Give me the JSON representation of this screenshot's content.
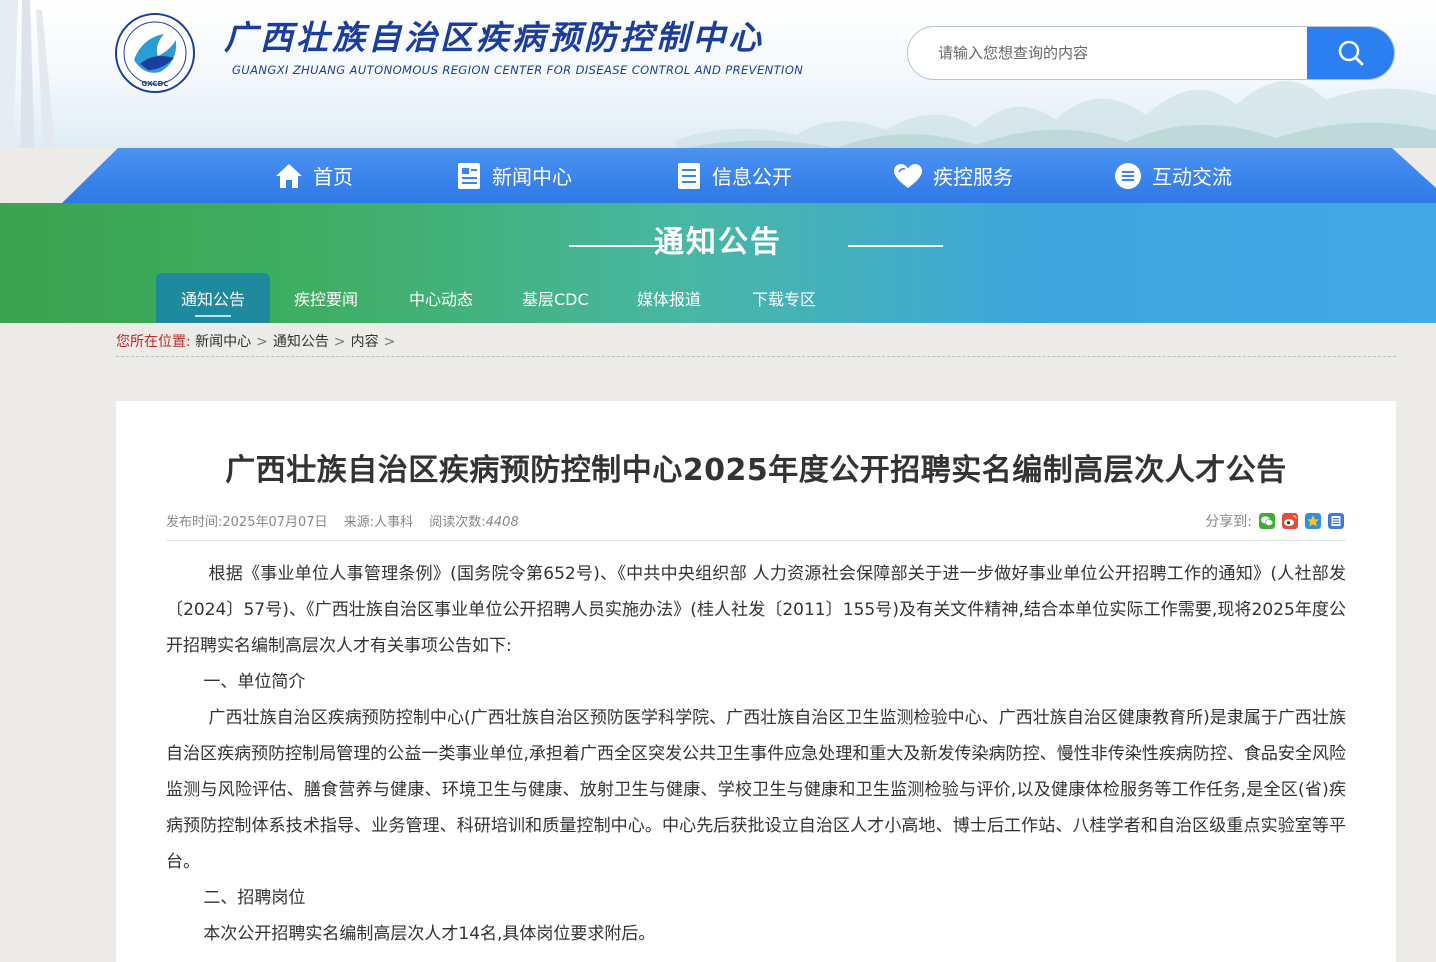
{
  "site": {
    "name_cn": "广西壮族自治区疾病预防控制中心",
    "name_en": "GUANGXI ZHUANG AUTONOMOUS REGION CENTER FOR DISEASE CONTROL AND PREVENTION",
    "logo_text": "GXCDC"
  },
  "search": {
    "placeholder": "请输入您想查询的内容"
  },
  "nav": {
    "items": [
      {
        "label": "首页",
        "icon": "home-icon"
      },
      {
        "label": "新闻中心",
        "icon": "news-icon"
      },
      {
        "label": "信息公开",
        "icon": "document-icon"
      },
      {
        "label": "疾控服务",
        "icon": "heart-icon"
      },
      {
        "label": "互动交流",
        "icon": "chat-icon"
      }
    ]
  },
  "banner": {
    "title": "通知公告"
  },
  "subnav": {
    "items": [
      {
        "label": "通知公告",
        "active": true
      },
      {
        "label": "疾控要闻"
      },
      {
        "label": "中心动态"
      },
      {
        "label": "基层CDC"
      },
      {
        "label": "媒体报道"
      },
      {
        "label": "下载专区"
      }
    ]
  },
  "breadcrumb": {
    "label": "您所在位置:",
    "items": [
      "新闻中心",
      "通知公告",
      "内容"
    ],
    "sep": ">"
  },
  "article": {
    "title": "广西壮族自治区疾病预防控制中心2025年度公开招聘实名编制高层次人才公告",
    "meta": {
      "date": "发布时间:2025年07月07日",
      "source": "来源:人事科",
      "views_label": "阅读次数:",
      "views": "4408"
    },
    "share_label": "分享到:",
    "paragraphs": [
      "根据《事业单位人事管理条例》(国务院令第652号)、《中共中央组织部 人力资源社会保障部关于进一步做好事业单位公开招聘工作的通知》(人社部发〔2024〕57号)、《广西壮族自治区事业单位公开招聘人员实施办法》(桂人社发〔2011〕155号)及有关文件精神,结合本单位实际工作需要,现将2025年度公开招聘实名编制高层次人才有关事项公告如下:",
      "一、单位简介",
      "广西壮族自治区疾病预防控制中心(广西壮族自治区预防医学科学院、广西壮族自治区卫生监测检验中心、广西壮族自治区健康教育所)是隶属于广西壮族自治区疾病预防控制局管理的公益一类事业单位,承担着广西全区突发公共卫生事件应急处理和重大及新发传染病防控、慢性非传染性疾病防控、食品安全风险监测与风险评估、膳食营养与健康、环境卫生与健康、放射卫生与健康、学校卫生与健康和卫生监测检验与评价,以及健康体检服务等工作任务,是全区(省)疾病预防控制体系技术指导、业务管理、科研培训和质量控制中心。中心先后获批设立自治区人才小高地、博士后工作站、八桂学者和自治区级重点实验室等平台。",
      "二、招聘岗位",
      "本次公开招聘实名编制高层次人才14名,具体岗位要求附后。"
    ]
  },
  "colors": {
    "brand_blue": "#1b3d9c",
    "nav_blue": "#3b83ee",
    "search_blue": "#2b7ff0",
    "banner_green": "#3fae63",
    "banner_blue": "#42a8e6",
    "breadcrumb_red": "#c62828"
  }
}
